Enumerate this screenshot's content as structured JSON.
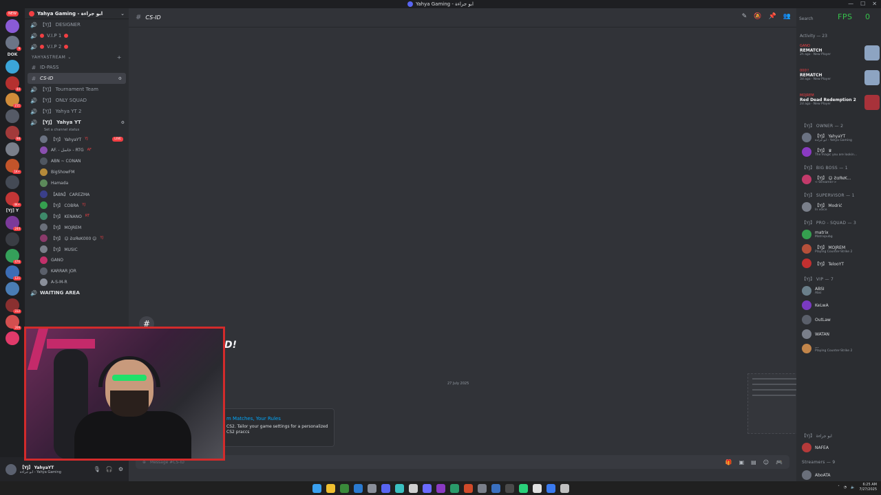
{
  "window": {
    "title": "Yahya Gaming - ابو جراءة",
    "controls": [
      "—",
      "☐",
      "✕"
    ]
  },
  "rail": {
    "new_badge": "NEW",
    "servers": [
      {
        "color": "#8a5bd6",
        "badge": ""
      },
      {
        "color": "#6c7587",
        "badge": "9"
      },
      {
        "color": "#3ba5d9",
        "badge": ""
      },
      {
        "color": "#b5302f",
        "badge": "44"
      },
      {
        "color": "#d08c3a",
        "badge": "211"
      },
      {
        "color": "#555a66",
        "badge": ""
      },
      {
        "color": "#a23a3a",
        "badge": "98"
      },
      {
        "color": "#7a7f8a",
        "badge": ""
      },
      {
        "color": "#c2542a",
        "badge": "1K+"
      },
      {
        "color": "#444a55",
        "badge": ""
      },
      {
        "color": "#c23636",
        "badge": "4K+"
      },
      {
        "color": "#7b3a9a",
        "badge": "244"
      },
      {
        "color": "#3a3d44",
        "badge": ""
      },
      {
        "color": "#35a05a",
        "badge": "476"
      },
      {
        "color": "#3c6db5",
        "badge": "121"
      },
      {
        "color": "#4a7db5",
        "badge": ""
      },
      {
        "color": "#8a3030",
        "badge": "312"
      },
      {
        "color": "#d34f4f",
        "badge": "209"
      },
      {
        "color": "#e03a6a",
        "badge": ""
      }
    ],
    "text_servers": [
      "DOK",
      "[YJ] Y"
    ]
  },
  "channels": {
    "guild_name": "Yahya Gaming - ابو جراءة",
    "items": [
      {
        "type": "voice",
        "label": "【YJ】 DESIGNER",
        "style": "dim"
      },
      {
        "type": "voice",
        "label": "V.I.P 1",
        "style": "dot"
      },
      {
        "type": "voice",
        "label": "V.I.P 2",
        "style": "dot"
      }
    ],
    "category": "YAHYASTREAM",
    "text_channels": [
      {
        "label": "ID-PASS"
      },
      {
        "label": "CS-ID",
        "selected": true
      }
    ],
    "voice_channels": [
      {
        "label": "【YJ】 Tournament Team"
      },
      {
        "label": "【YJ】 ONLY SQUAD"
      },
      {
        "label": "【YJ】 Yahya YT 2"
      },
      {
        "label": "【YJ】 Yahya YT",
        "bold": true
      }
    ],
    "set_status": "Set a channel status",
    "voice_users": [
      {
        "name": "【YJ】 YahyaYT",
        "tag": "YJ",
        "live": "LIVE",
        "color": "#6b7282"
      },
      {
        "name": "AF. - خاسل - RTG",
        "tag": "AF",
        "live": "",
        "color": "#8a4fb0"
      },
      {
        "name": "ABN ~ CONAN",
        "tag": "",
        "live": "",
        "color": "#4f5660"
      },
      {
        "name": "BigShowFM",
        "tag": "",
        "live": "",
        "color": "#b58a3a"
      },
      {
        "name": "Hamada",
        "tag": "",
        "live": "",
        "color": "#5c8a5a"
      },
      {
        "name": "【ABN】 CAREZMA",
        "tag": "",
        "live": "",
        "color": "#3a3f8a"
      },
      {
        "name": "【YJ】 COBRA",
        "tag": "YJ",
        "live": "",
        "color": "#35a04f"
      },
      {
        "name": "【YJ】 KENANO",
        "tag": "RT",
        "live": "",
        "color": "#3e8a6a"
      },
      {
        "name": "【YJ】 MOJREM",
        "tag": "",
        "live": "",
        "color": "#6a6f7a"
      },
      {
        "name": "【YJ】 ☺ ƧɑЯɐK000 ☺",
        "tag": "YJ",
        "live": "",
        "color": "#8a3a6a"
      },
      {
        "name": "【YJ】 MUSIC",
        "tag": "",
        "live": "",
        "color": "#7a7f8a"
      },
      {
        "name": "GANO",
        "tag": "",
        "live": "",
        "color": "#c2306a"
      },
      {
        "name": "KARRAR JOR",
        "tag": "",
        "live": "",
        "color": "#5a5f6a"
      },
      {
        "name": "A-S-M-R",
        "tag": "",
        "live": "",
        "color": "#8a8f9a"
      }
    ],
    "waiting_area": "WAITING AREA"
  },
  "user_panel": {
    "name": "【YJ】 YahyaYT",
    "status": "ابو جراءة - Yahya Gaming"
  },
  "main": {
    "channel_name": "CS-ID",
    "welcome_title": "D!",
    "date_separator": "27 July 2025",
    "promo_title": "m Matches, Your Rules",
    "promo_desc": "CS2. Tailor your game settings for a personalized CS2 praccs",
    "composer_placeholder": "Message #CS-ID"
  },
  "members": {
    "search_placeholder": "Search",
    "fps_label": "FPS",
    "fps_value": "0",
    "activity_title": "Activity — 23",
    "activities": [
      {
        "name": "GANO",
        "game": "REMATCH",
        "meta": "2h ago · New Player",
        "thumb": "#8da4c2"
      },
      {
        "name": "000!!",
        "game": "REMATCH",
        "meta": "3d ago · New Player",
        "thumb": "#8da4c2"
      },
      {
        "name": "MOJREM",
        "game": "Red Dead Redemption 2",
        "meta": "2d ago · New Player",
        "thumb": "#a8323a"
      }
    ],
    "groups": [
      {
        "title": "【YJ】 OWNER — 2",
        "members": [
          {
            "name": "【YJ】 YahyaYT",
            "status": "ابو جراءة - Yahya Gaming",
            "color": "#6b7282"
          },
          {
            "name": "【YJ】 ♛",
            "status": "The magic you are lookin...",
            "color": "#8a3ac2"
          }
        ]
      },
      {
        "title": "【YJ】 BIG BOSS — 1",
        "members": [
          {
            "name": "【YJ】 ☺ ƧɑЯɐK...",
            "status": "<-Streamer->",
            "color": "#c23a6a"
          }
        ]
      },
      {
        "title": "【YJ】 SUPERVISOR — 1",
        "members": [
          {
            "name": "【YJ】 Modrić",
            "status": "In voice",
            "color": "#7a7f8a"
          }
        ]
      },
      {
        "title": "【YJ】 PRO - SQUAD — 3",
        "members": [
          {
            "name": "matrix",
            "status": "Matrixpubg",
            "color": "#35a04f"
          },
          {
            "name": "【YJ】 MOJREM",
            "status": "Playing Counter-Strike 2",
            "color": "#b5503a"
          },
          {
            "name": "【YJ】 TelooYT",
            "status": "",
            "color": "#c23030"
          }
        ]
      },
      {
        "title": "【YJ】 VIP — 7",
        "members": [
          {
            "name": "ABSI",
            "status": "Absi",
            "color": "#6a7f8a"
          },
          {
            "name": "KeLwA",
            "status": "",
            "color": "#7a3ac2"
          },
          {
            "name": "OutLaw",
            "status": "",
            "color": "#5a5f6a"
          },
          {
            "name": "WATAN",
            "status": "",
            "color": "#7a7f8a"
          },
          {
            "name": "...",
            "status": "Playing Counter-Strike 2",
            "color": "#c2854a"
          }
        ]
      },
      {
        "title": "【YJ】 ابو جراءة",
        "members": [
          {
            "name": "NAFEA",
            "status": "",
            "color": "#b53a3a"
          }
        ]
      },
      {
        "title": "Streamers — 9",
        "members": [
          {
            "name": "AboATA",
            "status": "",
            "color": "#6a6f7a"
          }
        ]
      }
    ]
  },
  "taskbar": {
    "apps": [
      "#3aa0f0",
      "#f0c030",
      "#3a8a3a",
      "#2a7ad0",
      "#8a8f9a",
      "#5865f2",
      "#3ac0c0",
      "#d0d0d0",
      "#6a6aff",
      "#8a3ac2",
      "#2a9a6a",
      "#d04a2a",
      "#7a7f8a",
      "#3a70c0",
      "#4a4a4a",
      "#2ad07a",
      "#e0e0e0",
      "#3a7af0",
      "#c0c0c0"
    ],
    "time": "6:25 AM",
    "date": "7/27/2025"
  },
  "colors": {
    "accent": "#5865f2",
    "danger": "#f23f43",
    "fps": "#36c24b",
    "webcam_border": "#d32b2b"
  }
}
